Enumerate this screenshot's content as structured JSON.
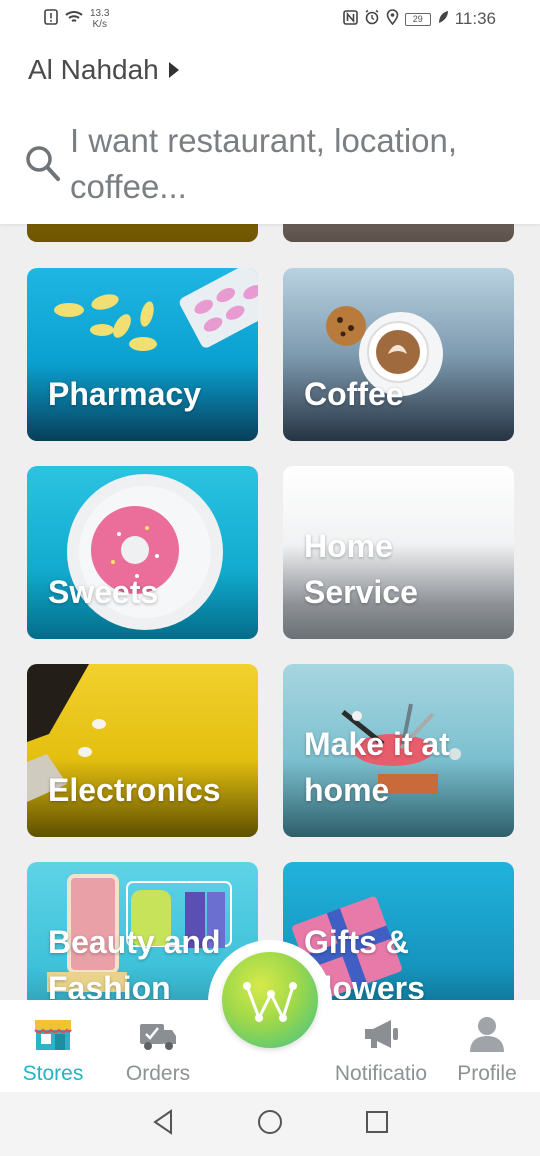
{
  "status_bar": {
    "net_speed_value": "13.3",
    "net_speed_unit": "K/s",
    "battery": "29",
    "time": "11:36"
  },
  "header": {
    "location": "Al Nahdah",
    "search_placeholder": "I want restaurant, location, coffee..."
  },
  "categories": [
    {
      "label": "Pharmacy"
    },
    {
      "label": "Coffee"
    },
    {
      "label": "Sweets"
    },
    {
      "label": "Home\nService"
    },
    {
      "label": "Electronics"
    },
    {
      "label": "Make it at\nhome"
    },
    {
      "label": "Beauty and\nFashion"
    },
    {
      "label": "Gifts &\nFlowers"
    }
  ],
  "bottom_nav": {
    "stores": "Stores",
    "orders": "Orders",
    "notifications": "Notificatio",
    "profile": "Profile"
  },
  "colors": {
    "accent": "#23b3c5",
    "inactive": "#8d9296"
  }
}
